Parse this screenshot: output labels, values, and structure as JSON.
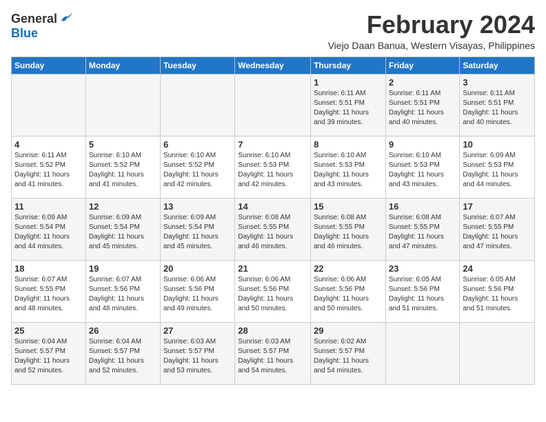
{
  "logo": {
    "general": "General",
    "blue": "Blue"
  },
  "title": "February 2024",
  "subtitle": "Viejo Daan Banua, Western Visayas, Philippines",
  "headers": [
    "Sunday",
    "Monday",
    "Tuesday",
    "Wednesday",
    "Thursday",
    "Friday",
    "Saturday"
  ],
  "weeks": [
    [
      {
        "day": "",
        "info": ""
      },
      {
        "day": "",
        "info": ""
      },
      {
        "day": "",
        "info": ""
      },
      {
        "day": "",
        "info": ""
      },
      {
        "day": "1",
        "info": "Sunrise: 6:11 AM\nSunset: 5:51 PM\nDaylight: 11 hours\nand 39 minutes."
      },
      {
        "day": "2",
        "info": "Sunrise: 6:11 AM\nSunset: 5:51 PM\nDaylight: 11 hours\nand 40 minutes."
      },
      {
        "day": "3",
        "info": "Sunrise: 6:11 AM\nSunset: 5:51 PM\nDaylight: 11 hours\nand 40 minutes."
      }
    ],
    [
      {
        "day": "4",
        "info": "Sunrise: 6:11 AM\nSunset: 5:52 PM\nDaylight: 11 hours\nand 41 minutes."
      },
      {
        "day": "5",
        "info": "Sunrise: 6:10 AM\nSunset: 5:52 PM\nDaylight: 11 hours\nand 41 minutes."
      },
      {
        "day": "6",
        "info": "Sunrise: 6:10 AM\nSunset: 5:52 PM\nDaylight: 11 hours\nand 42 minutes."
      },
      {
        "day": "7",
        "info": "Sunrise: 6:10 AM\nSunset: 5:53 PM\nDaylight: 11 hours\nand 42 minutes."
      },
      {
        "day": "8",
        "info": "Sunrise: 6:10 AM\nSunset: 5:53 PM\nDaylight: 11 hours\nand 43 minutes."
      },
      {
        "day": "9",
        "info": "Sunrise: 6:10 AM\nSunset: 5:53 PM\nDaylight: 11 hours\nand 43 minutes."
      },
      {
        "day": "10",
        "info": "Sunrise: 6:09 AM\nSunset: 5:53 PM\nDaylight: 11 hours\nand 44 minutes."
      }
    ],
    [
      {
        "day": "11",
        "info": "Sunrise: 6:09 AM\nSunset: 5:54 PM\nDaylight: 11 hours\nand 44 minutes."
      },
      {
        "day": "12",
        "info": "Sunrise: 6:09 AM\nSunset: 5:54 PM\nDaylight: 11 hours\nand 45 minutes."
      },
      {
        "day": "13",
        "info": "Sunrise: 6:09 AM\nSunset: 5:54 PM\nDaylight: 11 hours\nand 45 minutes."
      },
      {
        "day": "14",
        "info": "Sunrise: 6:08 AM\nSunset: 5:55 PM\nDaylight: 11 hours\nand 46 minutes."
      },
      {
        "day": "15",
        "info": "Sunrise: 6:08 AM\nSunset: 5:55 PM\nDaylight: 11 hours\nand 46 minutes."
      },
      {
        "day": "16",
        "info": "Sunrise: 6:08 AM\nSunset: 5:55 PM\nDaylight: 11 hours\nand 47 minutes."
      },
      {
        "day": "17",
        "info": "Sunrise: 6:07 AM\nSunset: 5:55 PM\nDaylight: 11 hours\nand 47 minutes."
      }
    ],
    [
      {
        "day": "18",
        "info": "Sunrise: 6:07 AM\nSunset: 5:55 PM\nDaylight: 11 hours\nand 48 minutes."
      },
      {
        "day": "19",
        "info": "Sunrise: 6:07 AM\nSunset: 5:56 PM\nDaylight: 11 hours\nand 48 minutes."
      },
      {
        "day": "20",
        "info": "Sunrise: 6:06 AM\nSunset: 5:56 PM\nDaylight: 11 hours\nand 49 minutes."
      },
      {
        "day": "21",
        "info": "Sunrise: 6:06 AM\nSunset: 5:56 PM\nDaylight: 11 hours\nand 50 minutes."
      },
      {
        "day": "22",
        "info": "Sunrise: 6:06 AM\nSunset: 5:56 PM\nDaylight: 11 hours\nand 50 minutes."
      },
      {
        "day": "23",
        "info": "Sunrise: 6:05 AM\nSunset: 5:56 PM\nDaylight: 11 hours\nand 51 minutes."
      },
      {
        "day": "24",
        "info": "Sunrise: 6:05 AM\nSunset: 5:56 PM\nDaylight: 11 hours\nand 51 minutes."
      }
    ],
    [
      {
        "day": "25",
        "info": "Sunrise: 6:04 AM\nSunset: 5:57 PM\nDaylight: 11 hours\nand 52 minutes."
      },
      {
        "day": "26",
        "info": "Sunrise: 6:04 AM\nSunset: 5:57 PM\nDaylight: 11 hours\nand 52 minutes."
      },
      {
        "day": "27",
        "info": "Sunrise: 6:03 AM\nSunset: 5:57 PM\nDaylight: 11 hours\nand 53 minutes."
      },
      {
        "day": "28",
        "info": "Sunrise: 6:03 AM\nSunset: 5:57 PM\nDaylight: 11 hours\nand 54 minutes."
      },
      {
        "day": "29",
        "info": "Sunrise: 6:02 AM\nSunset: 5:57 PM\nDaylight: 11 hours\nand 54 minutes."
      },
      {
        "day": "",
        "info": ""
      },
      {
        "day": "",
        "info": ""
      }
    ]
  ]
}
